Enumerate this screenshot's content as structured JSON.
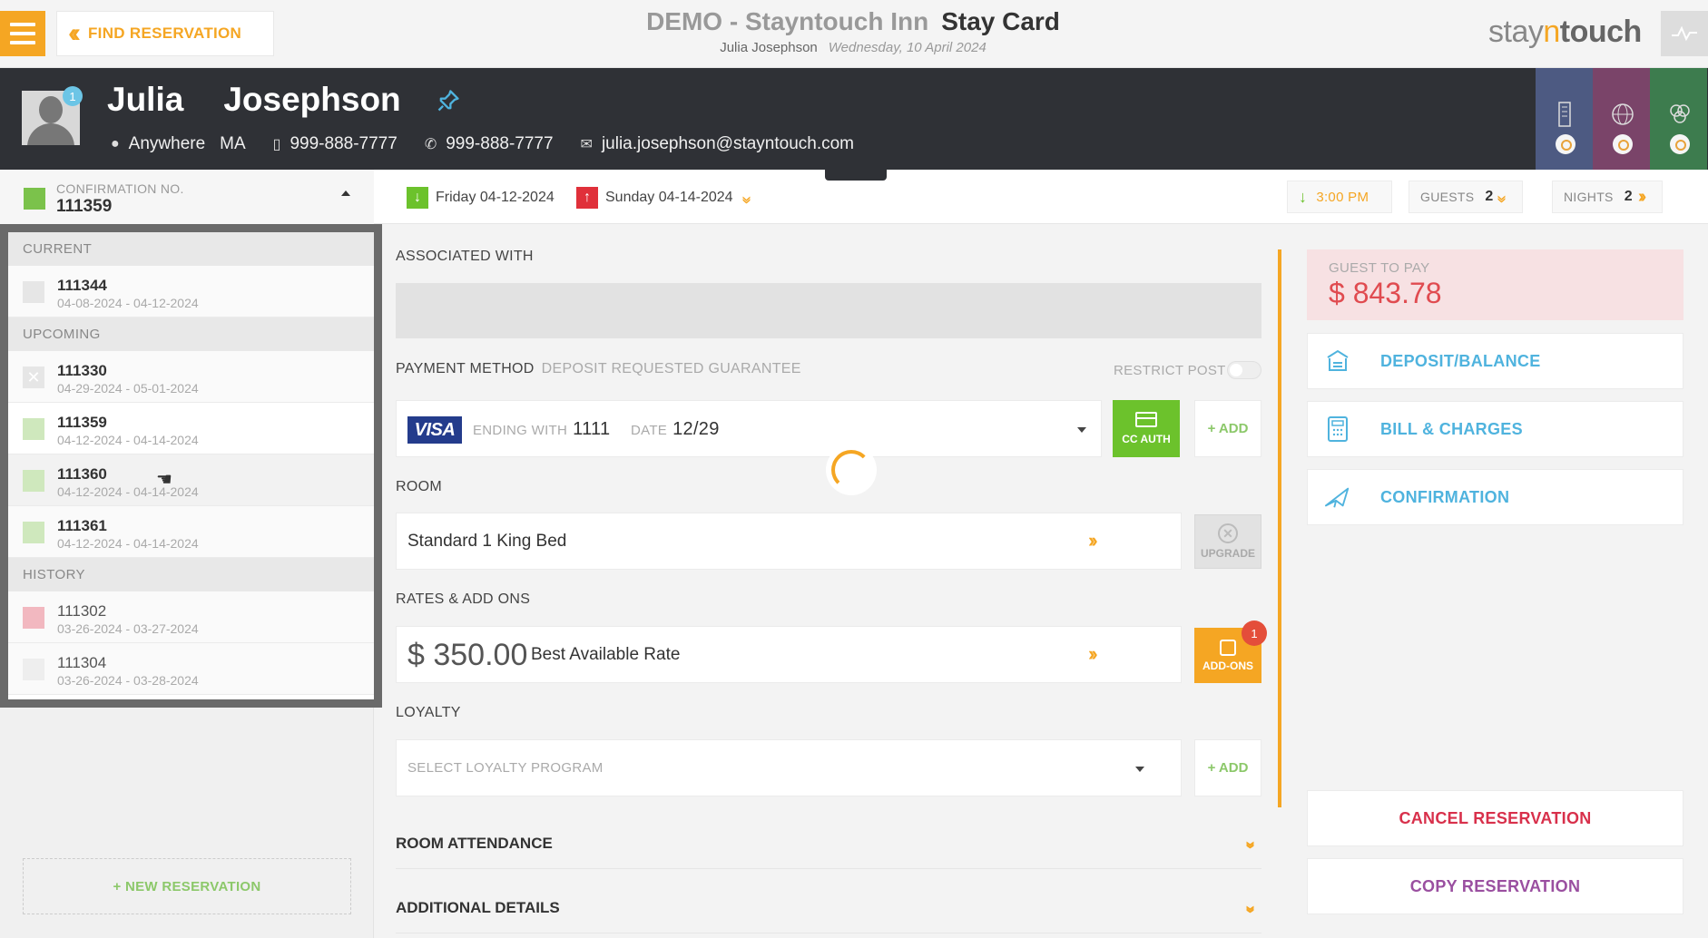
{
  "topbar": {
    "find_reservation": "FIND RESERVATION",
    "property": "DEMO - Stayntouch Inn",
    "page": "Stay Card",
    "guest": "Julia Josephson",
    "date": "Wednesday, 10 April 2024",
    "brand_a": "stay",
    "brand_n": "n",
    "brand_b": "touch"
  },
  "guest": {
    "first_name": "Julia",
    "last_name": "Josephson",
    "badge": "1",
    "city": "Anywhere",
    "state": "MA",
    "mobile": "999-888-7777",
    "phone": "999-888-7777",
    "email": "julia.josephson@stayntouch.com"
  },
  "confirmation": {
    "label": "CONFIRMATION NO.",
    "number": "111359"
  },
  "reservations": {
    "current_label": "CURRENT",
    "upcoming_label": "UPCOMING",
    "history_label": "HISTORY",
    "current": [
      {
        "number": "111344",
        "dates": "04-08-2024 - 04-12-2024",
        "color": "#e6e6e6"
      }
    ],
    "upcoming": [
      {
        "number": "111330",
        "dates": "04-29-2024 - 05-01-2024",
        "color": "#e6e6e6",
        "cancelled": true
      },
      {
        "number": "111359",
        "dates": "04-12-2024 - 04-14-2024",
        "color": "#cfe8bd"
      },
      {
        "number": "111360",
        "dates": "04-12-2024 - 04-14-2024",
        "color": "#cfe8bd"
      },
      {
        "number": "111361",
        "dates": "04-12-2024 - 04-14-2024",
        "color": "#cfe8bd"
      }
    ],
    "history": [
      {
        "number": "111302",
        "dates": "03-26-2024 - 03-27-2024",
        "color": "#f2b8c0"
      },
      {
        "number": "111304",
        "dates": "03-26-2024 - 03-28-2024",
        "color": "#eeeeee"
      }
    ],
    "new_reservation": "+ NEW RESERVATION"
  },
  "stay": {
    "arrival": "Friday 04-12-2024",
    "departure": "Sunday 04-14-2024",
    "arrival_time": "3:00 PM",
    "guests_label": "GUESTS",
    "guests": "2",
    "nights_label": "NIGHTS",
    "nights": "2"
  },
  "sections": {
    "associated_with": "ASSOCIATED WITH",
    "payment_method": "PAYMENT METHOD",
    "payment_sub": "DEPOSIT REQUESTED GUARANTEE",
    "restrict_post": "RESTRICT POST",
    "room": "ROOM",
    "rates": "RATES & ADD ONS",
    "loyalty": "LOYALTY",
    "room_attendance": "ROOM ATTENDANCE",
    "additional_details": "ADDITIONAL DETAILS"
  },
  "payment": {
    "card": "VISA",
    "ending_label": "ENDING WITH",
    "ending": "1111",
    "date_label": "DATE",
    "date": "12/29",
    "cc_auth": "CC AUTH",
    "add": "+ ADD"
  },
  "room": {
    "type": "Standard 1 King Bed",
    "upgrade": "UPGRADE"
  },
  "rate": {
    "amount": "$ 350.00",
    "name": "Best Available Rate",
    "addons": "ADD-ONS",
    "addons_count": "1"
  },
  "loyalty": {
    "placeholder": "SELECT LOYALTY PROGRAM",
    "add": "+ ADD"
  },
  "billing": {
    "guest_to_pay_label": "GUEST TO PAY",
    "guest_to_pay": "$ 843.78",
    "deposit_balance": "DEPOSIT/BALANCE",
    "bill_charges": "BILL & CHARGES",
    "confirmation": "CONFIRMATION",
    "cancel": "CANCEL RESERVATION",
    "copy": "COPY RESERVATION"
  },
  "colors": {
    "accent": "#f5a623",
    "link": "#4fb3de",
    "green": "#6cc22c",
    "cancel": "#d8304b",
    "copy": "#9a4fa0"
  }
}
